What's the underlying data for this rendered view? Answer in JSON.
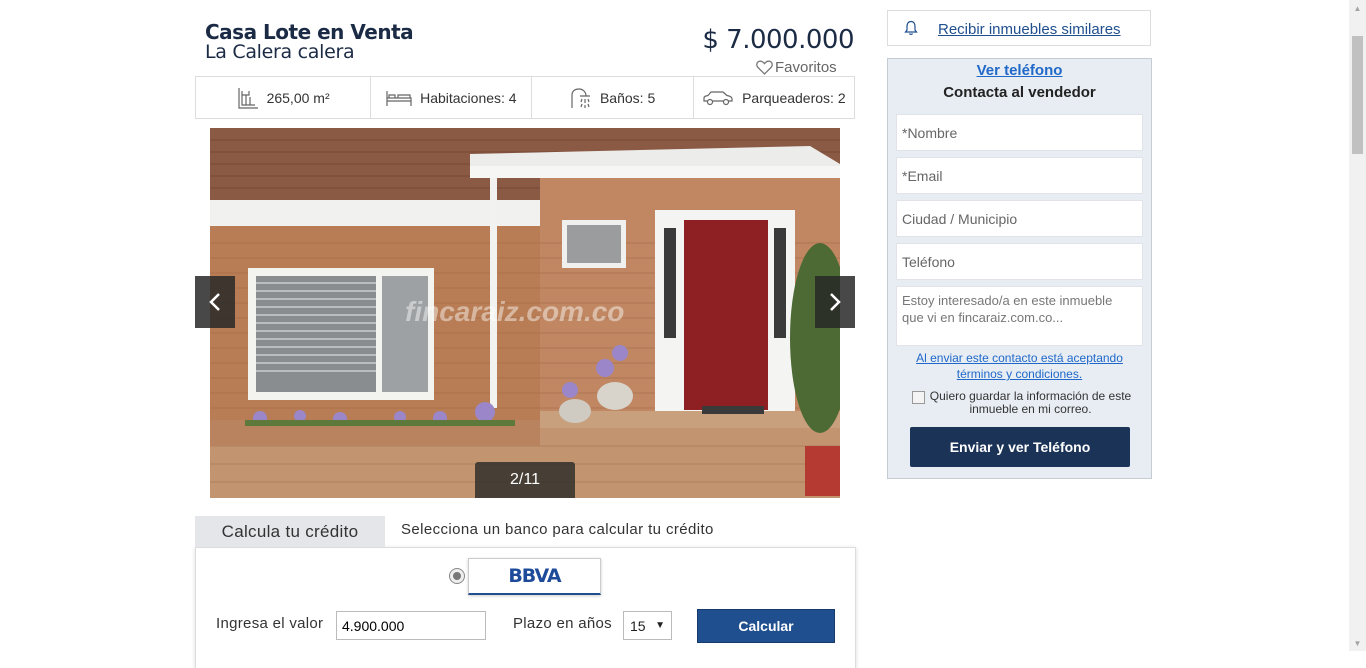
{
  "listing": {
    "title": "Casa Lote en Venta",
    "location": "La Calera calera",
    "price": "$ 7.000.000",
    "favorites_label": "Favoritos"
  },
  "features": [
    {
      "icon": "area-icon",
      "label": "265,00 m²"
    },
    {
      "icon": "bed-icon",
      "label": "Habitaciones: 4"
    },
    {
      "icon": "shower-icon",
      "label": "Baños: 5"
    },
    {
      "icon": "car-icon",
      "label": "Parqueaderos: 2"
    }
  ],
  "gallery": {
    "counter": "2/11",
    "watermark": "fincaraiz.com.co"
  },
  "credit": {
    "tab_label": "Calcula tu crédito",
    "message": "Selecciona un banco para calcular tu crédito",
    "bank_name": "BBVA",
    "value_label": "Ingresa el valor",
    "value": "4.900.000",
    "term_label": "Plazo en años",
    "term_value": "15",
    "calculate_label": "Calcular"
  },
  "alerts": {
    "link_label": "Recibir inmuebles similares"
  },
  "contact": {
    "show_phone_label": "Ver teléfono",
    "title": "Contacta al vendedor",
    "name_placeholder": "*Nombre",
    "email_placeholder": "*Email",
    "city_placeholder": "Ciudad / Municipio",
    "phone_placeholder": "Teléfono",
    "message_placeholder": "Estoy interesado/a en este inmueble que vi en fincaraiz.com.co...",
    "terms_line1": "Al enviar este contacto está aceptando",
    "terms_line2": "términos y condiciones.",
    "save_info_label": "Quiero guardar la información de este inmueble en mi correo.",
    "submit_label": "Enviar y ver Teléfono"
  },
  "colors": {
    "brand_navy": "#1c3358",
    "link_blue": "#2069c9",
    "button_blue": "#1f4f8f",
    "contact_bg": "#e7edf3"
  }
}
